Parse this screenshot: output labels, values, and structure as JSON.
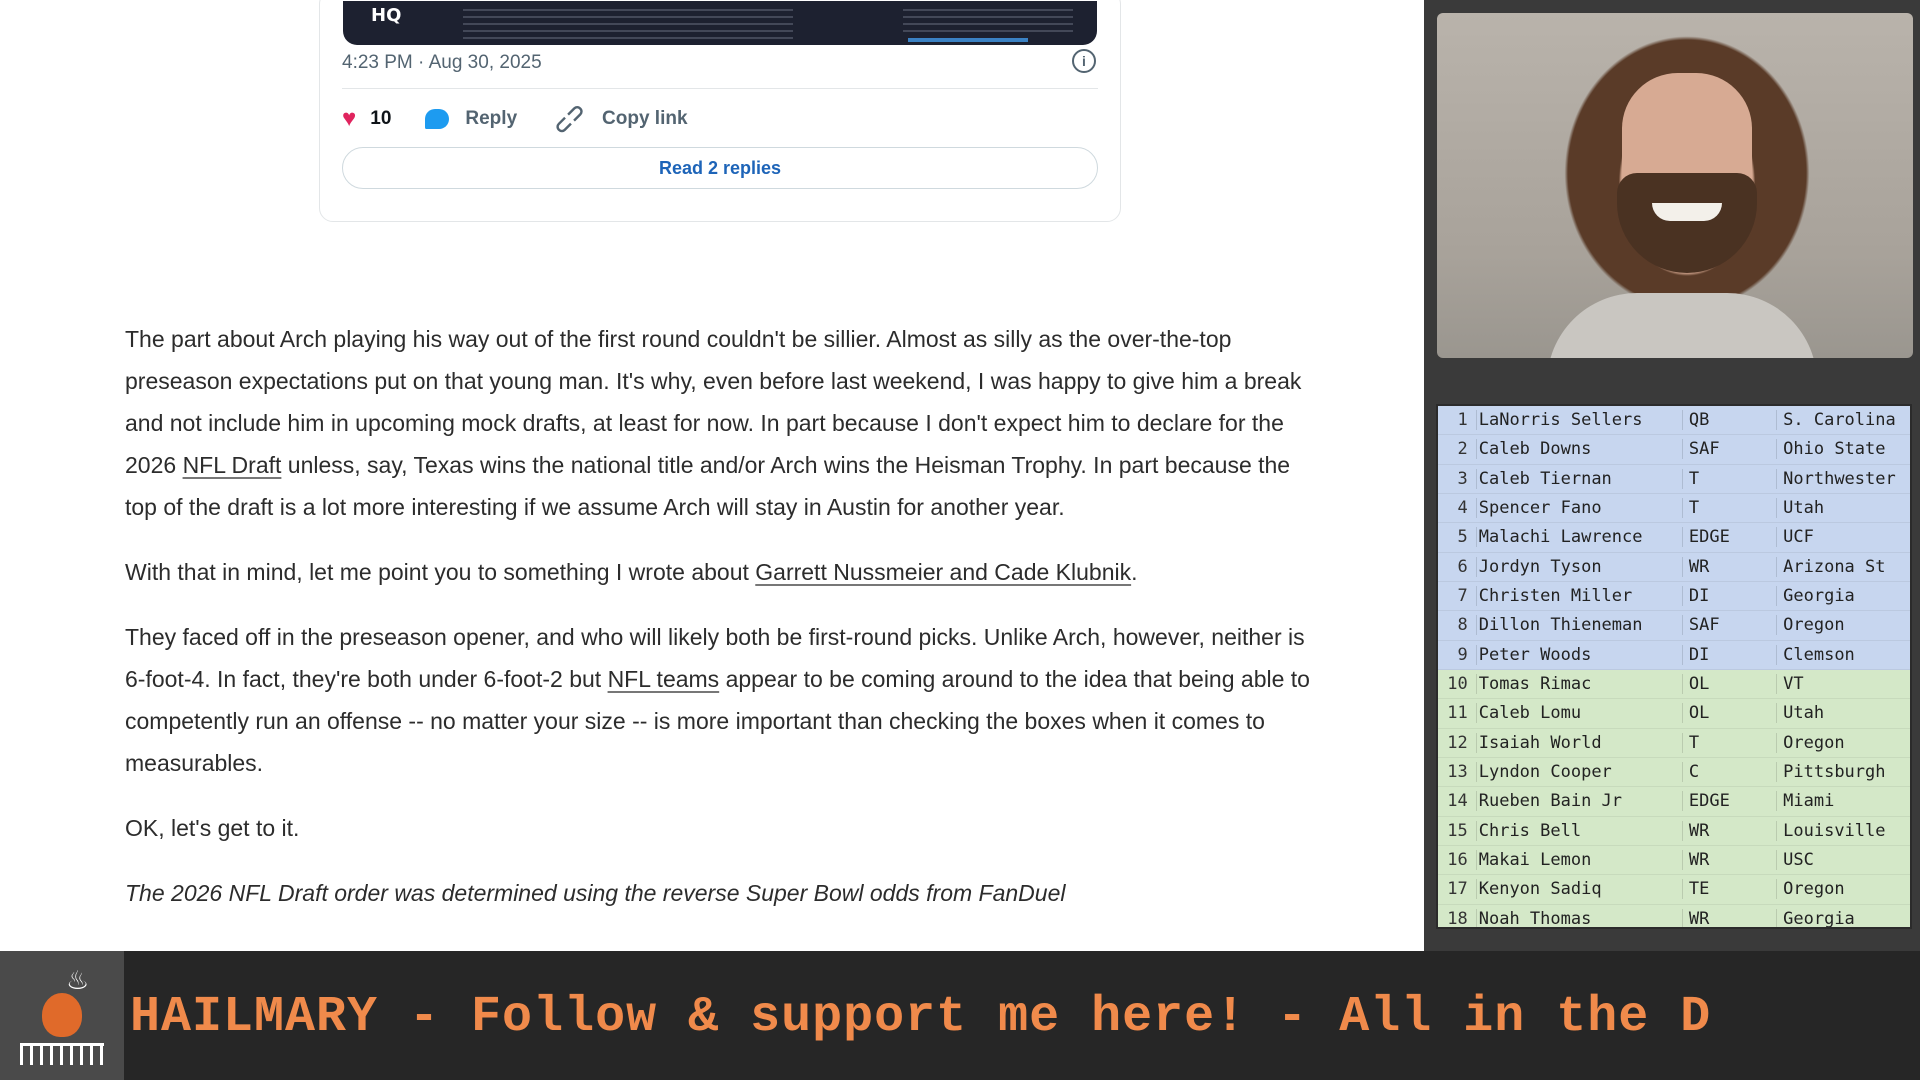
{
  "tweet": {
    "timestamp": "4:23 PM · Aug 30, 2025",
    "media_brand": "HQ",
    "likes": "10",
    "reply_label": "Reply",
    "copy_link_label": "Copy link",
    "read_replies_label": "Read 2 replies"
  },
  "article": {
    "p1": {
      "before": "The part about Arch playing his way out of the first round couldn't be sillier. Almost as silly as the over-the-top preseason expectations put on that young man. It's why, even before last weekend, I was happy to give him a break and not include him in upcoming mock drafts, at least for now. In part because I don't expect him to declare for the 2026 ",
      "link": "NFL Draft",
      "after": " unless, say, Texas wins the national title and/or Arch wins the Heisman Trophy. In part because the top of the draft is a lot more interesting if we assume Arch will stay in Austin for another year."
    },
    "p2": {
      "before": "With that in mind, let me point you to something I wrote about ",
      "link": "Garrett Nussmeier and Cade Klubnik",
      "after": "."
    },
    "p3": {
      "before": "They faced off in the preseason opener, and who will likely both be first-round picks. Unlike Arch, however, neither is 6-foot-4. In fact, they're both under 6-foot-2 but ",
      "link": "NFL teams",
      "after": " appear to be coming around to the idea that being able to competently run an offense -- no matter your size -- is more important than checking the boxes when it comes to measurables."
    },
    "p4": "OK, let's get to it.",
    "p5": "The 2026 NFL Draft order was determined using the reverse Super Bowl odds from FanDuel"
  },
  "roster": [
    {
      "num": "1",
      "name": "LaNorris Sellers",
      "pos": "QB",
      "school": "S. Carolina",
      "group": "blue"
    },
    {
      "num": "2",
      "name": "Caleb Downs",
      "pos": "SAF",
      "school": "Ohio State",
      "group": "blue"
    },
    {
      "num": "3",
      "name": "Caleb Tiernan",
      "pos": "T",
      "school": "Northwester",
      "group": "blue"
    },
    {
      "num": "4",
      "name": "Spencer Fano",
      "pos": "T",
      "school": "Utah",
      "group": "blue"
    },
    {
      "num": "5",
      "name": "Malachi Lawrence",
      "pos": "EDGE",
      "school": "UCF",
      "group": "blue"
    },
    {
      "num": "6",
      "name": "Jordyn Tyson",
      "pos": "WR",
      "school": "Arizona St",
      "group": "blue"
    },
    {
      "num": "7",
      "name": "Christen Miller",
      "pos": "DI",
      "school": "Georgia",
      "group": "blue"
    },
    {
      "num": "8",
      "name": "Dillon Thieneman",
      "pos": "SAF",
      "school": "Oregon",
      "group": "blue"
    },
    {
      "num": "9",
      "name": "Peter Woods",
      "pos": "DI",
      "school": "Clemson",
      "group": "blue"
    },
    {
      "num": "10",
      "name": "Tomas Rimac",
      "pos": "OL",
      "school": "VT",
      "group": "green"
    },
    {
      "num": "11",
      "name": "Caleb Lomu",
      "pos": "OL",
      "school": "Utah",
      "group": "green"
    },
    {
      "num": "12",
      "name": "Isaiah World",
      "pos": "T",
      "school": "Oregon",
      "group": "green"
    },
    {
      "num": "13",
      "name": "Lyndon Cooper",
      "pos": "C",
      "school": "Pittsburgh",
      "group": "green"
    },
    {
      "num": "14",
      "name": "Rueben Bain Jr",
      "pos": "EDGE",
      "school": "Miami",
      "group": "green"
    },
    {
      "num": "15",
      "name": "Chris Bell",
      "pos": "WR",
      "school": "Louisville",
      "group": "green"
    },
    {
      "num": "16",
      "name": "Makai Lemon",
      "pos": "WR",
      "school": "USC",
      "group": "green"
    },
    {
      "num": "17",
      "name": "Kenyon Sadiq",
      "pos": "TE",
      "school": "Oregon",
      "group": "green"
    },
    {
      "num": "18",
      "name": "Noah Thomas",
      "pos": "WR",
      "school": "Georgia",
      "group": "green"
    }
  ],
  "ticker": {
    "text": "HAILMARY  -    Follow & support me here!  -  All in the D"
  },
  "colors": {
    "ticker_text": "#f08a4b",
    "roster_top_group": "#c7d6ef",
    "roster_bottom_group": "#d4e8c8",
    "like_heart": "#e0245e",
    "reply_bubble": "#1d9bf0",
    "read_replies_link": "#1d64b8"
  },
  "icons": [
    "info-icon",
    "heart-icon",
    "reply-bubble-icon",
    "link-icon",
    "football-grill-logo-icon"
  ]
}
